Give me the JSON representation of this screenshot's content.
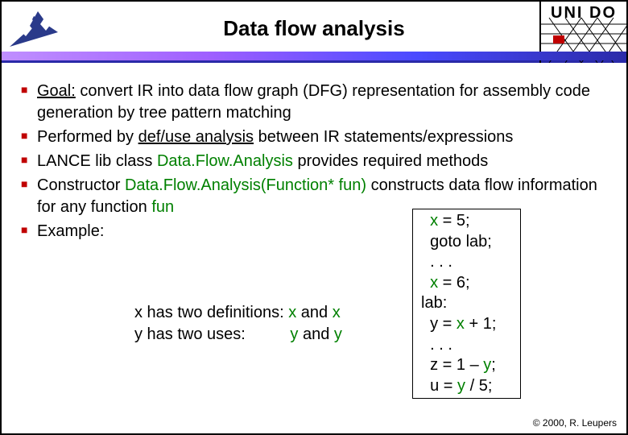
{
  "header": {
    "title": "Data flow analysis",
    "right_logo_text": "UNI DO"
  },
  "bullets": {
    "b1a": "Goal:",
    "b1b": " convert IR into data flow graph (DFG) representation for assembly code generation by tree pattern matching",
    "b2a": "Performed by ",
    "b2b": "def/use analysis",
    "b2c": " between IR statements/expressions",
    "b3a": "LANCE lib class ",
    "b3b": "Data.Flow.Analysis",
    "b3c": " provides required methods",
    "b4a": "Constructor ",
    "b4b": "Data.Flow.Analysis(Function* fun)",
    "b4c": " constructs data flow information for any function ",
    "b4d": "fun",
    "b5": "Example:"
  },
  "defs": {
    "l1a": "x has two definitions: ",
    "l1b": "x",
    "l1c": " and ",
    "l1d": "x",
    "l2a": "y has two uses:",
    "l2pad": "          ",
    "l2b": "y",
    "l2c": " and ",
    "l2d": "y"
  },
  "code": {
    "l1a": "x",
    "l1b": " = 5;",
    "l2": "goto lab;",
    "l3": ". . .",
    "l4a": "x",
    "l4b": " = 6;",
    "l5": "lab:",
    "l6a": "y = ",
    "l6b": "x",
    "l6c": " + 1;",
    "l7": ". . .",
    "l8a": "z = 1 – ",
    "l8b": "y",
    "l8c": ";",
    "l9a": "u = ",
    "l9b": "y",
    "l9c": " / 5;"
  },
  "copyright": "© 2000, R. Leupers"
}
